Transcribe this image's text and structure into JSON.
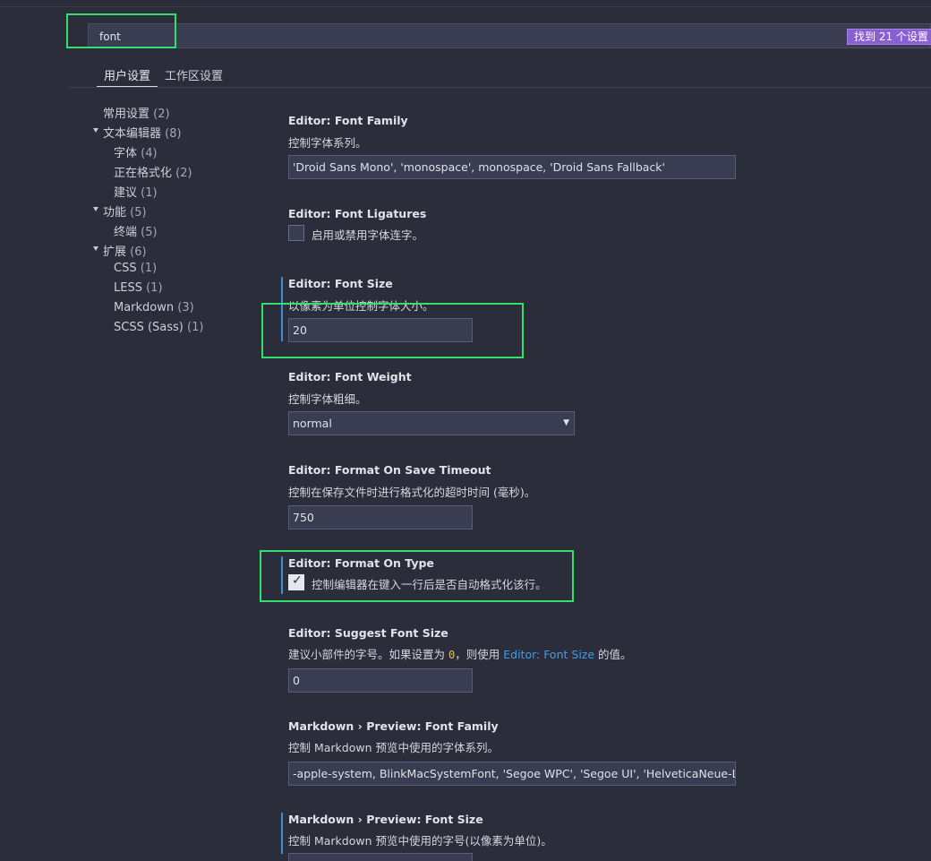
{
  "search": {
    "value": "font",
    "result_count": "找到 21 个设置"
  },
  "tabs": [
    {
      "label": "用户设置",
      "active": true
    },
    {
      "label": "工作区设置",
      "active": false
    }
  ],
  "toc": [
    {
      "label": "常用设置",
      "count": "(2)",
      "expanded": null
    },
    {
      "label": "文本编辑器",
      "count": "(8)",
      "expanded": true
    },
    {
      "label": "字体",
      "count": "(4)",
      "expanded": null
    },
    {
      "label": "正在格式化",
      "count": "(2)",
      "expanded": null
    },
    {
      "label": "建议",
      "count": "(1)",
      "expanded": null
    },
    {
      "label": "功能",
      "count": "(5)",
      "expanded": true
    },
    {
      "label": "终端",
      "count": "(5)",
      "expanded": null
    },
    {
      "label": "扩展",
      "count": "(6)",
      "expanded": true
    },
    {
      "label": "CSS",
      "count": "(1)",
      "expanded": null
    },
    {
      "label": "LESS",
      "count": "(1)",
      "expanded": null
    },
    {
      "label": "Markdown",
      "count": "(3)",
      "expanded": null
    },
    {
      "label": "SCSS (Sass)",
      "count": "(1)",
      "expanded": null
    }
  ],
  "settings": {
    "font_family": {
      "title": "Editor: Font Family",
      "desc": "控制字体系列。",
      "value": "'Droid Sans Mono', 'monospace', monospace, 'Droid Sans Fallback'"
    },
    "font_ligatures": {
      "title": "Editor: Font Ligatures",
      "label": "启用或禁用字体连字。",
      "checked": false
    },
    "font_size": {
      "title": "Editor: Font Size",
      "desc": "以像素为单位控制字体大小。",
      "value": "20",
      "modified": true
    },
    "font_weight": {
      "title": "Editor: Font Weight",
      "desc": "控制字体粗细。",
      "value": "normal",
      "arrow": "▼"
    },
    "format_on_save_timeout": {
      "title": "Editor: Format On Save Timeout",
      "desc": "控制在保存文件时进行格式化的超时时间 (毫秒)。",
      "value": "750"
    },
    "format_on_type": {
      "title": "Editor: Format On Type",
      "label": "控制编辑器在键入一行后是否自动格式化该行。",
      "checked": true,
      "checkmark": "✓",
      "modified": true
    },
    "suggest_font_size": {
      "title": "Editor: Suggest Font Size",
      "desc_prefix": "建议小部件的字号。如果设置为",
      "desc_code": "0",
      "desc_mid": "，则使用",
      "desc_link": "Editor: Font Size",
      "desc_suffix": "的值。",
      "value": "0"
    },
    "md_font_family": {
      "title": "Markdown › Preview: Font Family",
      "desc": "控制 Markdown 预览中使用的字体系列。",
      "value": "-apple-system, BlinkMacSystemFont, 'Segoe WPC', 'Segoe UI', 'HelveticaNeue-L..."
    },
    "md_font_size": {
      "title": "Markdown › Preview: Font Size",
      "desc": "控制 Markdown 预览中使用的字号(以像素为单位)。",
      "modified": true
    }
  },
  "colors": {
    "background": "#2b2d3b",
    "input_bg": "#3a3d52",
    "badge": "#8a5fd1",
    "highlight_annotation": "#35e06a",
    "modified_indicator": "#3f8fd6",
    "link": "#3f9ee8"
  }
}
